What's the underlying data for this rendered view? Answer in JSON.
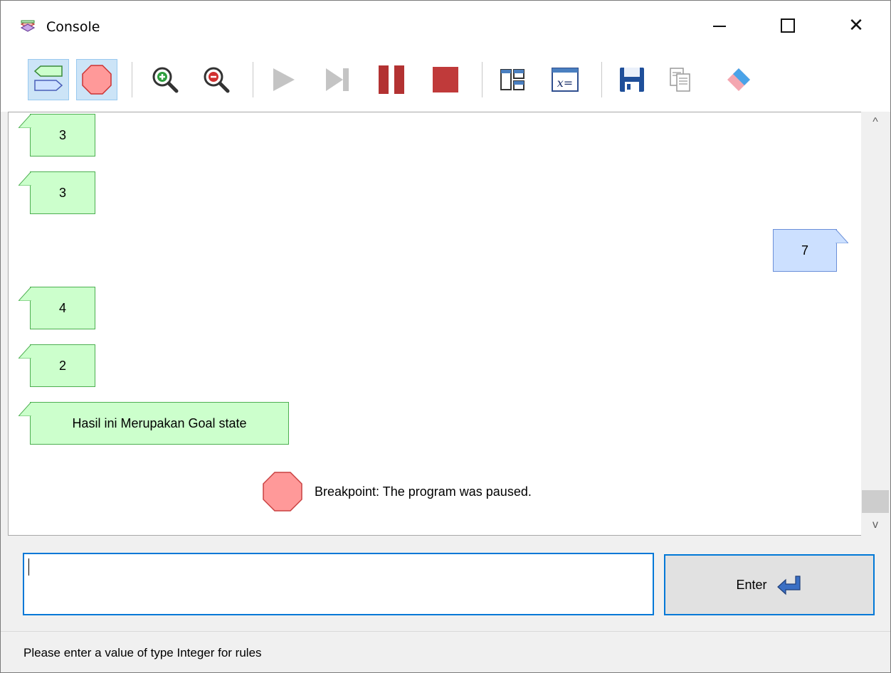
{
  "window": {
    "title": "Console"
  },
  "titlebar_buttons": {
    "close_glyph": "✕"
  },
  "toolbar": {
    "items": [
      {
        "name": "show-messages-toggle-icon",
        "toggled": true
      },
      {
        "name": "breakpoint-toggle-icon",
        "toggled": true
      },
      {
        "name": "zoom-in-icon"
      },
      {
        "name": "zoom-out-icon"
      },
      {
        "name": "run-icon"
      },
      {
        "name": "step-icon"
      },
      {
        "name": "pause-icon"
      },
      {
        "name": "stop-icon"
      },
      {
        "name": "layout-icon"
      },
      {
        "name": "variables-icon"
      },
      {
        "name": "save-icon"
      },
      {
        "name": "copy-icon"
      },
      {
        "name": "eraser-icon"
      }
    ],
    "variables_icon_text": "x="
  },
  "console": {
    "messages": [
      {
        "type": "output",
        "text": "3"
      },
      {
        "type": "output",
        "text": "3"
      },
      {
        "type": "input",
        "text": "7"
      },
      {
        "type": "output",
        "text": "4"
      },
      {
        "type": "output",
        "text": "2"
      },
      {
        "type": "output",
        "text": "Hasil ini Merupakan Goal state"
      }
    ],
    "breakpoint_message": "Breakpoint: The program was paused."
  },
  "scrollbar": {
    "up_glyph": "^",
    "down_glyph": "v"
  },
  "input": {
    "value": "",
    "placeholder": ""
  },
  "enter_button": {
    "label": "Enter"
  },
  "status": {
    "text": "Please enter a value of type Integer for rules"
  },
  "colors": {
    "output_bubble": "#ccffcc",
    "input_bubble": "#cce0ff",
    "breakpoint": "#ff9999",
    "accent": "#0078d7"
  }
}
